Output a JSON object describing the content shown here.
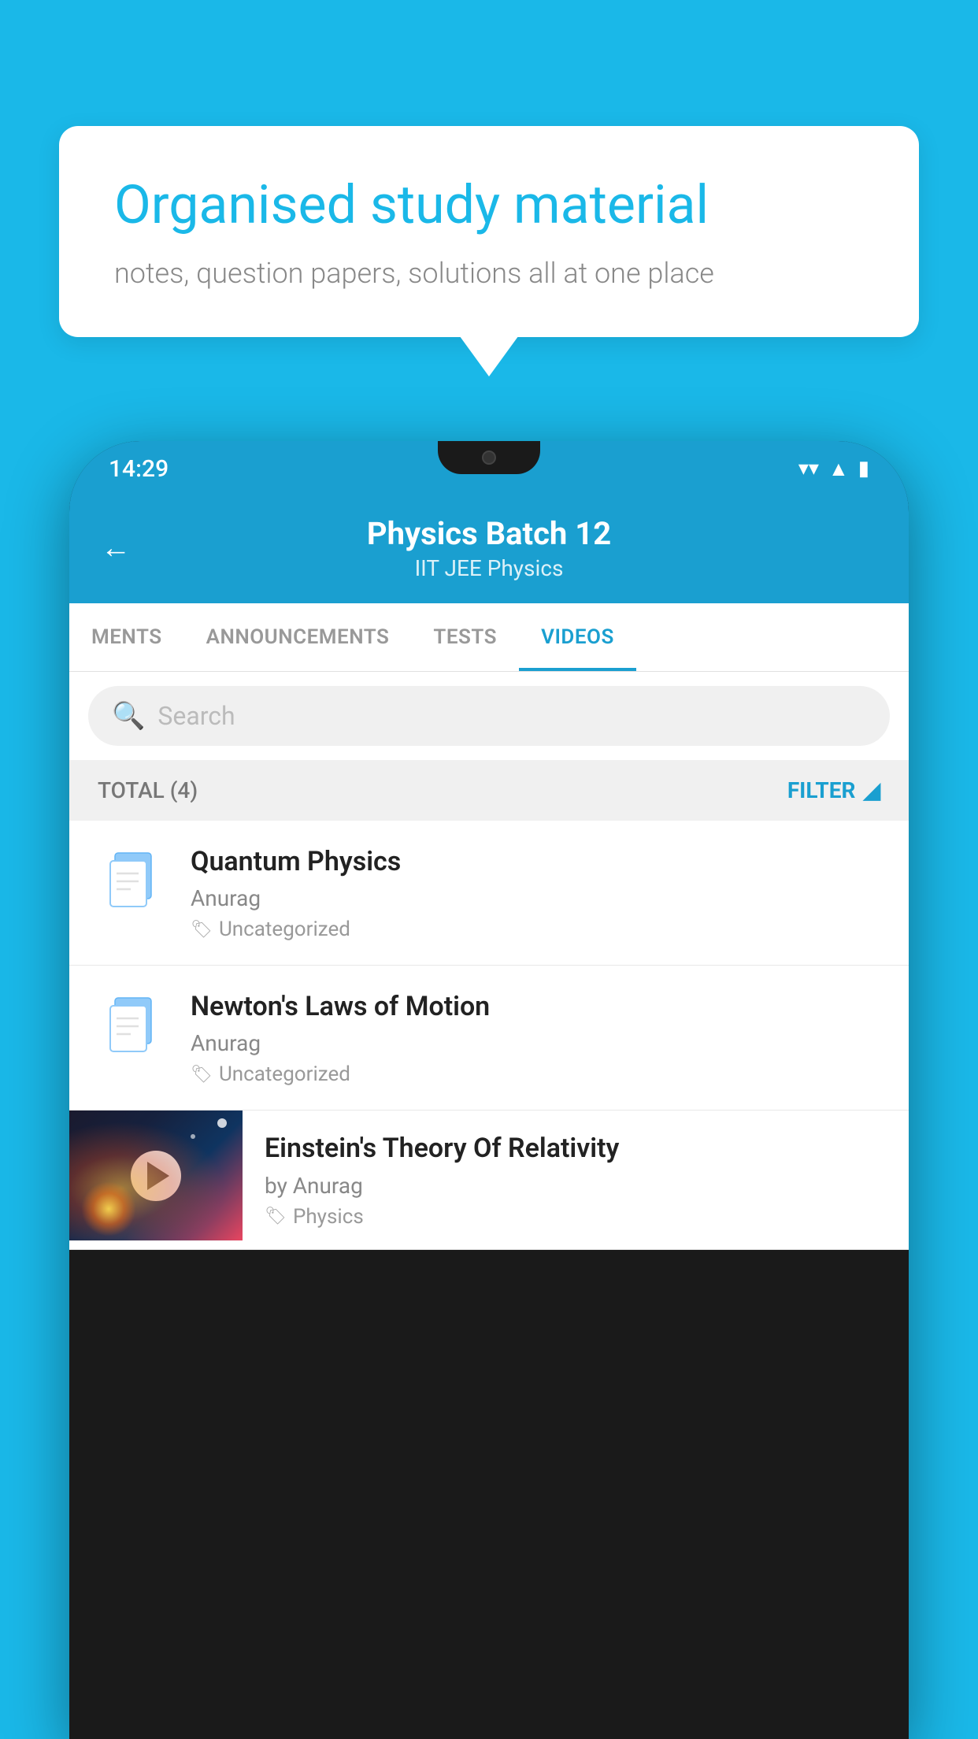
{
  "background_color": "#1ab8e8",
  "bubble": {
    "title": "Organised study material",
    "subtitle": "notes, question papers, solutions all at one place"
  },
  "status_bar": {
    "time": "14:29",
    "wifi_icon": "▾",
    "signal_icon": "▾",
    "battery_icon": "▮"
  },
  "header": {
    "title": "Physics Batch 12",
    "subtitle": "IIT JEE   Physics",
    "back_label": "←"
  },
  "tabs": [
    {
      "label": "MENTS",
      "active": false
    },
    {
      "label": "ANNOUNCEMENTS",
      "active": false
    },
    {
      "label": "TESTS",
      "active": false
    },
    {
      "label": "VIDEOS",
      "active": true
    }
  ],
  "search": {
    "placeholder": "Search"
  },
  "filter": {
    "total_label": "TOTAL (4)",
    "filter_label": "FILTER"
  },
  "videos": [
    {
      "id": 1,
      "title": "Quantum Physics",
      "author": "Anurag",
      "tag": "Uncategorized",
      "has_thumb": false
    },
    {
      "id": 2,
      "title": "Newton's Laws of Motion",
      "author": "Anurag",
      "tag": "Uncategorized",
      "has_thumb": false
    },
    {
      "id": 3,
      "title": "Einstein's Theory Of Relativity",
      "author": "by Anurag",
      "tag": "Physics",
      "has_thumb": true
    }
  ],
  "colors": {
    "brand_blue": "#1a9fd0",
    "accent": "#1ab8e8",
    "text_dark": "#222222",
    "text_muted": "#888888",
    "text_light": "#bbbbbb"
  }
}
